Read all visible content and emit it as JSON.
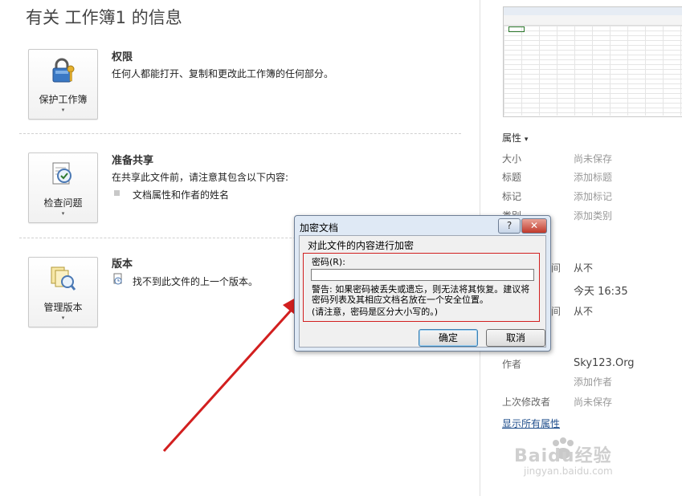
{
  "page": {
    "title": "有关 工作簿1 的信息"
  },
  "sections": [
    {
      "button_label": "保护工作簿",
      "title": "权限",
      "description": "任何人都能打开、复制和更改此工作簿的任何部分。"
    },
    {
      "button_label": "检查问题",
      "title": "准备共享",
      "description": "在共享此文件前，请注意其包含以下内容:",
      "bullets": [
        "文档属性和作者的姓名"
      ]
    },
    {
      "button_label": "管理版本",
      "title": "版本",
      "description": "找不到此文件的上一个版本。"
    }
  ],
  "dropdown_arrow": "▾",
  "properties": {
    "header": "属性",
    "rows": [
      {
        "label": "大小",
        "value": "尚未保存"
      },
      {
        "label": "标题",
        "value": "添加标题"
      },
      {
        "label": "标记",
        "value": "添加标记"
      },
      {
        "label": "类别",
        "value": "添加类别"
      }
    ],
    "dates": [
      {
        "label_tail": "间",
        "value": "从不"
      },
      {
        "label_tail": "",
        "value": "今天 16:35"
      },
      {
        "label_tail": "间",
        "value": "从不"
      }
    ],
    "author_label": "作者",
    "author_value": "Sky123.Org",
    "add_author": "添加作者",
    "last_modified_label": "上次修改者",
    "last_modified_value": "尚未保存",
    "show_all": "显示所有属性"
  },
  "dialog": {
    "title": "加密文档",
    "help_glyph": "?",
    "close_glyph": "✕",
    "group_label": "对此文件的内容进行加密",
    "password_label": "密码(R):",
    "password_value": "",
    "warning": "警告: 如果密码被丢失或遗忘，则无法将其恢复。建议将密码列表及其相应文档名放在一个安全位置。",
    "note": "(请注意，密码是区分大小写的。)",
    "ok_label": "确定",
    "cancel_label": "取消"
  },
  "watermark": {
    "brand": "Baidu经验",
    "url": "jingyan.baidu.com"
  },
  "colors": {
    "annotation_red": "#d21f1f",
    "link_blue": "#1f4e8c"
  }
}
